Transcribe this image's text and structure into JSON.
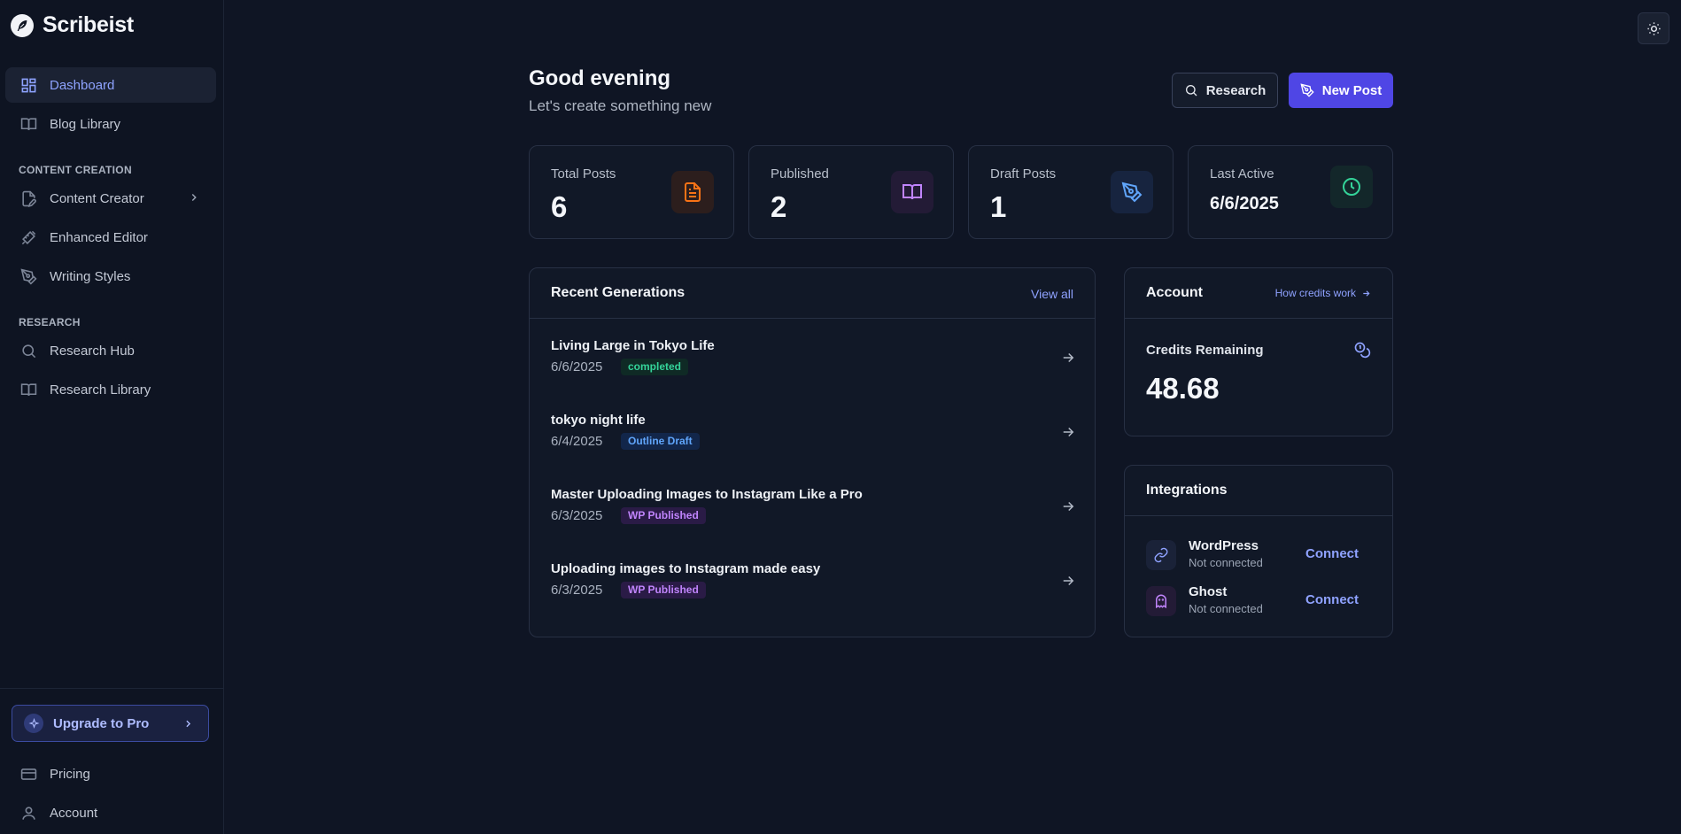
{
  "app": {
    "name": "Scribeist"
  },
  "sidebar": {
    "items": [
      {
        "label": "Dashboard",
        "icon": "dashboard-icon"
      },
      {
        "label": "Blog Library",
        "icon": "book-open-icon"
      },
      {
        "label": "Content Creator",
        "icon": "file-pen-icon"
      },
      {
        "label": "Enhanced Editor",
        "icon": "ruler-pencil-icon"
      },
      {
        "label": "Writing Styles",
        "icon": "pen-tool-icon"
      },
      {
        "label": "Research Hub",
        "icon": "search-icon"
      },
      {
        "label": "Research Library",
        "icon": "book-open-icon"
      }
    ],
    "sections": {
      "content_creation": "CONTENT CREATION",
      "research": "RESEARCH"
    },
    "upgrade_label": "Upgrade to Pro",
    "bottom_items": [
      {
        "label": "Pricing",
        "icon": "credit-card-icon"
      },
      {
        "label": "Account",
        "icon": "user-icon"
      }
    ]
  },
  "header": {
    "greeting": "Good evening",
    "subtitle": "Let's create something new",
    "research_button": "Research",
    "new_post_button": "New Post"
  },
  "stats": [
    {
      "label": "Total Posts",
      "value": "6",
      "icon": "file-text-icon",
      "color": "#f97316"
    },
    {
      "label": "Published",
      "value": "2",
      "icon": "book-open-icon",
      "color": "#c084fc"
    },
    {
      "label": "Draft Posts",
      "value": "1",
      "icon": "pen-tool-icon",
      "color": "#60a5fa"
    },
    {
      "label": "Last Active",
      "value": "6/6/2025",
      "icon": "clock-icon",
      "color": "#34d399"
    }
  ],
  "recent": {
    "title": "Recent Generations",
    "view_all": "View all",
    "items": [
      {
        "title": "Living Large in Tokyo Life",
        "date": "6/6/2025",
        "status": "completed"
      },
      {
        "title": "tokyo night life",
        "date": "6/4/2025",
        "status": "Outline Draft"
      },
      {
        "title": "Master Uploading Images to Instagram Like a Pro",
        "date": "6/3/2025",
        "status": "WP Published"
      },
      {
        "title": "Uploading images to Instagram made easy",
        "date": "6/3/2025",
        "status": "WP Published"
      }
    ]
  },
  "account": {
    "title": "Account",
    "how_credits": "How credits work",
    "credits_label": "Credits Remaining",
    "credits_value": "48.68"
  },
  "integrations": {
    "title": "Integrations",
    "items": [
      {
        "name": "WordPress",
        "status": "Not connected",
        "action": "Connect",
        "icon": "link-icon"
      },
      {
        "name": "Ghost",
        "status": "Not connected",
        "action": "Connect",
        "icon": "ghost-icon"
      }
    ]
  },
  "colors": {
    "accent": "#4f46e5",
    "link": "#8fa2ff",
    "background": "#0f1524"
  }
}
